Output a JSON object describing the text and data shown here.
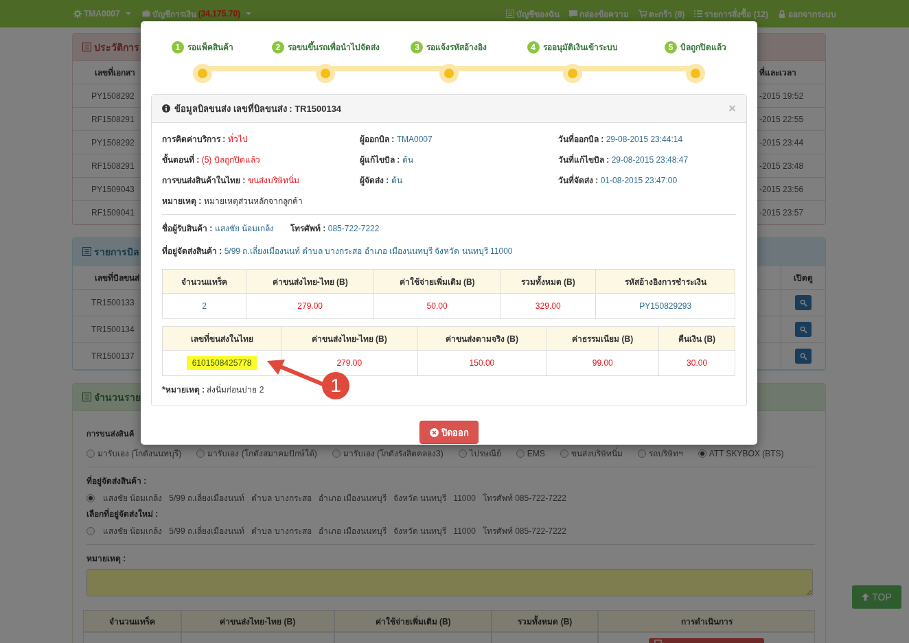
{
  "navbar": {
    "user": "TMA0007",
    "account_label": "บัญชีการเงิน",
    "account_balance": "(34,175.70)",
    "links": [
      "บัญชีของฉัน",
      "กล่องข้อความ",
      "ตะกร้า (8)",
      "รายการสั่งซื้อ (12)",
      "ออกจากระบบ"
    ]
  },
  "history": {
    "title": "ประวัติการ",
    "column_1": "เลขที่เอกสา",
    "column_2": "ที่และเวลา",
    "rows": [
      {
        "document": "PY1508292",
        "time": "-2015 19:52"
      },
      {
        "document": "RF1508291",
        "time": "-2015 22:55"
      },
      {
        "document": "PY1508292",
        "time": "-2015 23:44"
      },
      {
        "document": "RF1508291",
        "time": "-2015 23:48"
      },
      {
        "document": "PY1509043",
        "time": "-2015 23:56"
      },
      {
        "document": "RF1509041",
        "time": "-2015 23:57"
      }
    ]
  },
  "bills": {
    "title": "รายการบิล",
    "column_1": "เลขที่บิลขนส่",
    "column_2": "เปิดดู",
    "rows": [
      "TR1500133",
      "TR1500134",
      "TR1500137"
    ]
  },
  "summary": {
    "title": "จำนวนราย",
    "shipping_label": "การขนส่งสินค้",
    "shipping_options": [
      {
        "label": "มารับเอง (โกดังนนทบุรี)",
        "selected": false
      },
      {
        "label": "มารับเอง (โกดังสมาคมปักษ์ใต้)",
        "selected": false
      },
      {
        "label": "มารับเอง (โกดังรังสิตคลอง3)",
        "selected": false
      },
      {
        "label": "ไปรษณีย์",
        "selected": false
      },
      {
        "label": "EMS",
        "selected": false
      },
      {
        "label": "ขนส่งบริษัทนิ่ม",
        "selected": false
      },
      {
        "label": "รถบริษัทฯ",
        "selected": false
      },
      {
        "label": "ATT SKYBOX (BTS)",
        "selected": true
      }
    ],
    "address_label": "ที่อยู่จัดส่งสินค้า :",
    "address": {
      "text": "แสงชัย น้อมเกล้ง   5/99 ถ.เลี่ยงเมืองนนท์   ตำบล บางกระสอ   อำเภอ เมืองนนทบุรี   จังหวัด นนทบุรี   11000   โทรศัพท์ 085-722-7222",
      "selected": true
    },
    "new_address_label": "เลือกที่อยู่จัดส่งใหม่ :",
    "new_address": {
      "text": "แสงชัย น้อมเกล้ง   5/99 ถ.เลี่ยงเมืองนนท์   ตำบล บางกระสอ   อำเภอ เมืองนนทบุรี   จังหวัด นนทบุรี   11000   โทรศัพท์ 085-722-7222",
      "selected": false
    },
    "note_label": "หมายเหตุ :",
    "table_columns": [
      "จำนวนแทร็ค",
      "ค่าขนส่งไทย-ไทย (B)",
      "ค่าใช้จ่ายเพิ่มเติม (B)",
      "รวมทั้งหมด (B)",
      "การดำเนินการ"
    ]
  },
  "top_button": "TOP",
  "modal": {
    "steps": [
      {
        "number": "1",
        "label": "รอแพ็คสินค้า"
      },
      {
        "number": "2",
        "label": "รอขนขึ้นรถเพื่อนำไปจัดส่ง"
      },
      {
        "number": "3",
        "label": "รอแจ้งรหัสอ้างอิง"
      },
      {
        "number": "4",
        "label": "รออนุมัติเงินเข้าระบบ"
      },
      {
        "number": "5",
        "label": "บิลถูกปิดแล้ว"
      }
    ],
    "title": "ข้อมูลบิลขนส่ง เลขที่บิลขนส่ง : TR1500134",
    "close": "×",
    "info": [
      {
        "label": "การคิดค่าบริการ :",
        "value": "ทั่วไป",
        "kind": "danger"
      },
      {
        "label": "ผู้ออกบิล :",
        "value": "TMA0007",
        "kind": "info"
      },
      {
        "label": "วันที่ออกบิล :",
        "value": "29-08-2015 23:44:14",
        "kind": "info"
      },
      {
        "label": "ขั้นตอนที่ :",
        "value": "(5) บิลถูกปิดแล้ว",
        "kind": "danger"
      },
      {
        "label": "ผู้แก้ไขบิล :",
        "value": "ต้น",
        "kind": "info"
      },
      {
        "label": "วันที่แก้ไขบิล :",
        "value": "29-08-2015 23:48:47",
        "kind": "info"
      },
      {
        "label": "การขนส่งสินค้าในไทย :",
        "value": "ขนส่งบริษัทนิ่ม",
        "kind": "danger"
      },
      {
        "label": "ผู้จัดส่ง :",
        "value": "ต้น",
        "kind": "info"
      },
      {
        "label": "วันที่จัดส่ง :",
        "value": "01-08-2015 23:47:00",
        "kind": "info"
      },
      {
        "label": "หมายเหตุ :",
        "value": "หมายเหตุส่วนหลักจากลูกค้า",
        "kind": "plain"
      }
    ],
    "recipient": [
      {
        "label": "ชื่อผู้รับสินค้า :",
        "value": "แสงชัย   น้อมเกล้ง",
        "kind": "info"
      },
      {
        "label": "โทรศัพท์ :",
        "value": "085-722-7222",
        "kind": "info"
      }
    ],
    "delivery_address": {
      "label": "ที่อยู่จัดส่งสินค้า :",
      "value": "5/99 ถ.เลี่ยงเมืองนนท์   ตำบล บางกระสอ   อำเภอ เมืองนนทบุรี   จังหวัด นนทบุรี   11000",
      "kind": "info"
    },
    "tables": [
      {
        "columns": [
          "จำนวนแทร็ค",
          "ค่าขนส่งไทย-ไทย (B)",
          "ค่าใช้จ่ายเพิ่มเติม (B)",
          "รวมทั้งหมด (B)",
          "รหัสอ้างอิงการชำระเงิน"
        ],
        "cells": [
          {
            "text": "2",
            "kind": "info"
          },
          {
            "text": "279.00",
            "kind": "danger"
          },
          {
            "text": "50.00",
            "kind": "danger"
          },
          {
            "text": "329.00",
            "kind": "danger"
          },
          {
            "text": "PY150829293",
            "kind": "info"
          }
        ]
      },
      {
        "columns": [
          "เลขที่ขนส่งในไทย",
          "ค่าขนส่งไทย-ไทย (B)",
          "ค่าขนส่งตามจริง (B)",
          "ค่าธรรมเนียม (B)",
          "คืนเงิน (B)"
        ],
        "cells": [
          {
            "text": "6101508425778",
            "kind": "highlight"
          },
          {
            "text": "279.00",
            "kind": "danger"
          },
          {
            "text": "150.00",
            "kind": "danger"
          },
          {
            "text": "99.00",
            "kind": "danger"
          },
          {
            "text": "30.00",
            "kind": "danger"
          }
        ]
      }
    ],
    "note": {
      "label": "*หมายเหตุ :",
      "value": "ส่งนิ่มก่อนบ่าย 2"
    },
    "annotation": "1",
    "close_button": "ปิดออก"
  }
}
